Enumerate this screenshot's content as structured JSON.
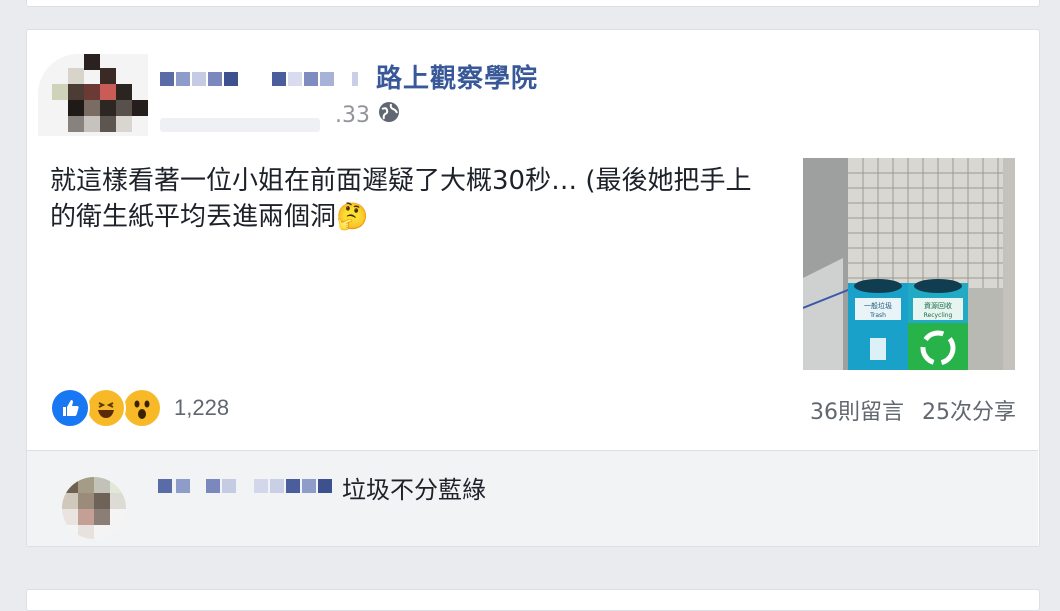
{
  "post": {
    "page_name": "路上觀察學院",
    "time_suffix": ".33",
    "text": "就這樣看著一位小姐在前面遲疑了大概30秒… (最後她把手上的衛生紙平均丟進兩個洞🤔",
    "photo": {
      "left_bin_label": "一般垃圾",
      "left_bin_sublabel": "Trash",
      "right_bin_label": "資源回收",
      "right_bin_sublabel": "Recycling"
    }
  },
  "reactions": {
    "icons": [
      "like-icon",
      "haha-icon",
      "wow-icon"
    ],
    "count": "1,228"
  },
  "stats": {
    "comments": "36則留言",
    "shares": "25次分享"
  },
  "comment": {
    "text": "垃圾不分藍綠"
  },
  "colors": {
    "link_blue": "#385898",
    "like_blue": "#1877f2",
    "emoji_yellow": "#f7b928",
    "bin_teal": "#1aa1c9",
    "bin_green": "#27b24a",
    "background": "#e9ebee"
  }
}
